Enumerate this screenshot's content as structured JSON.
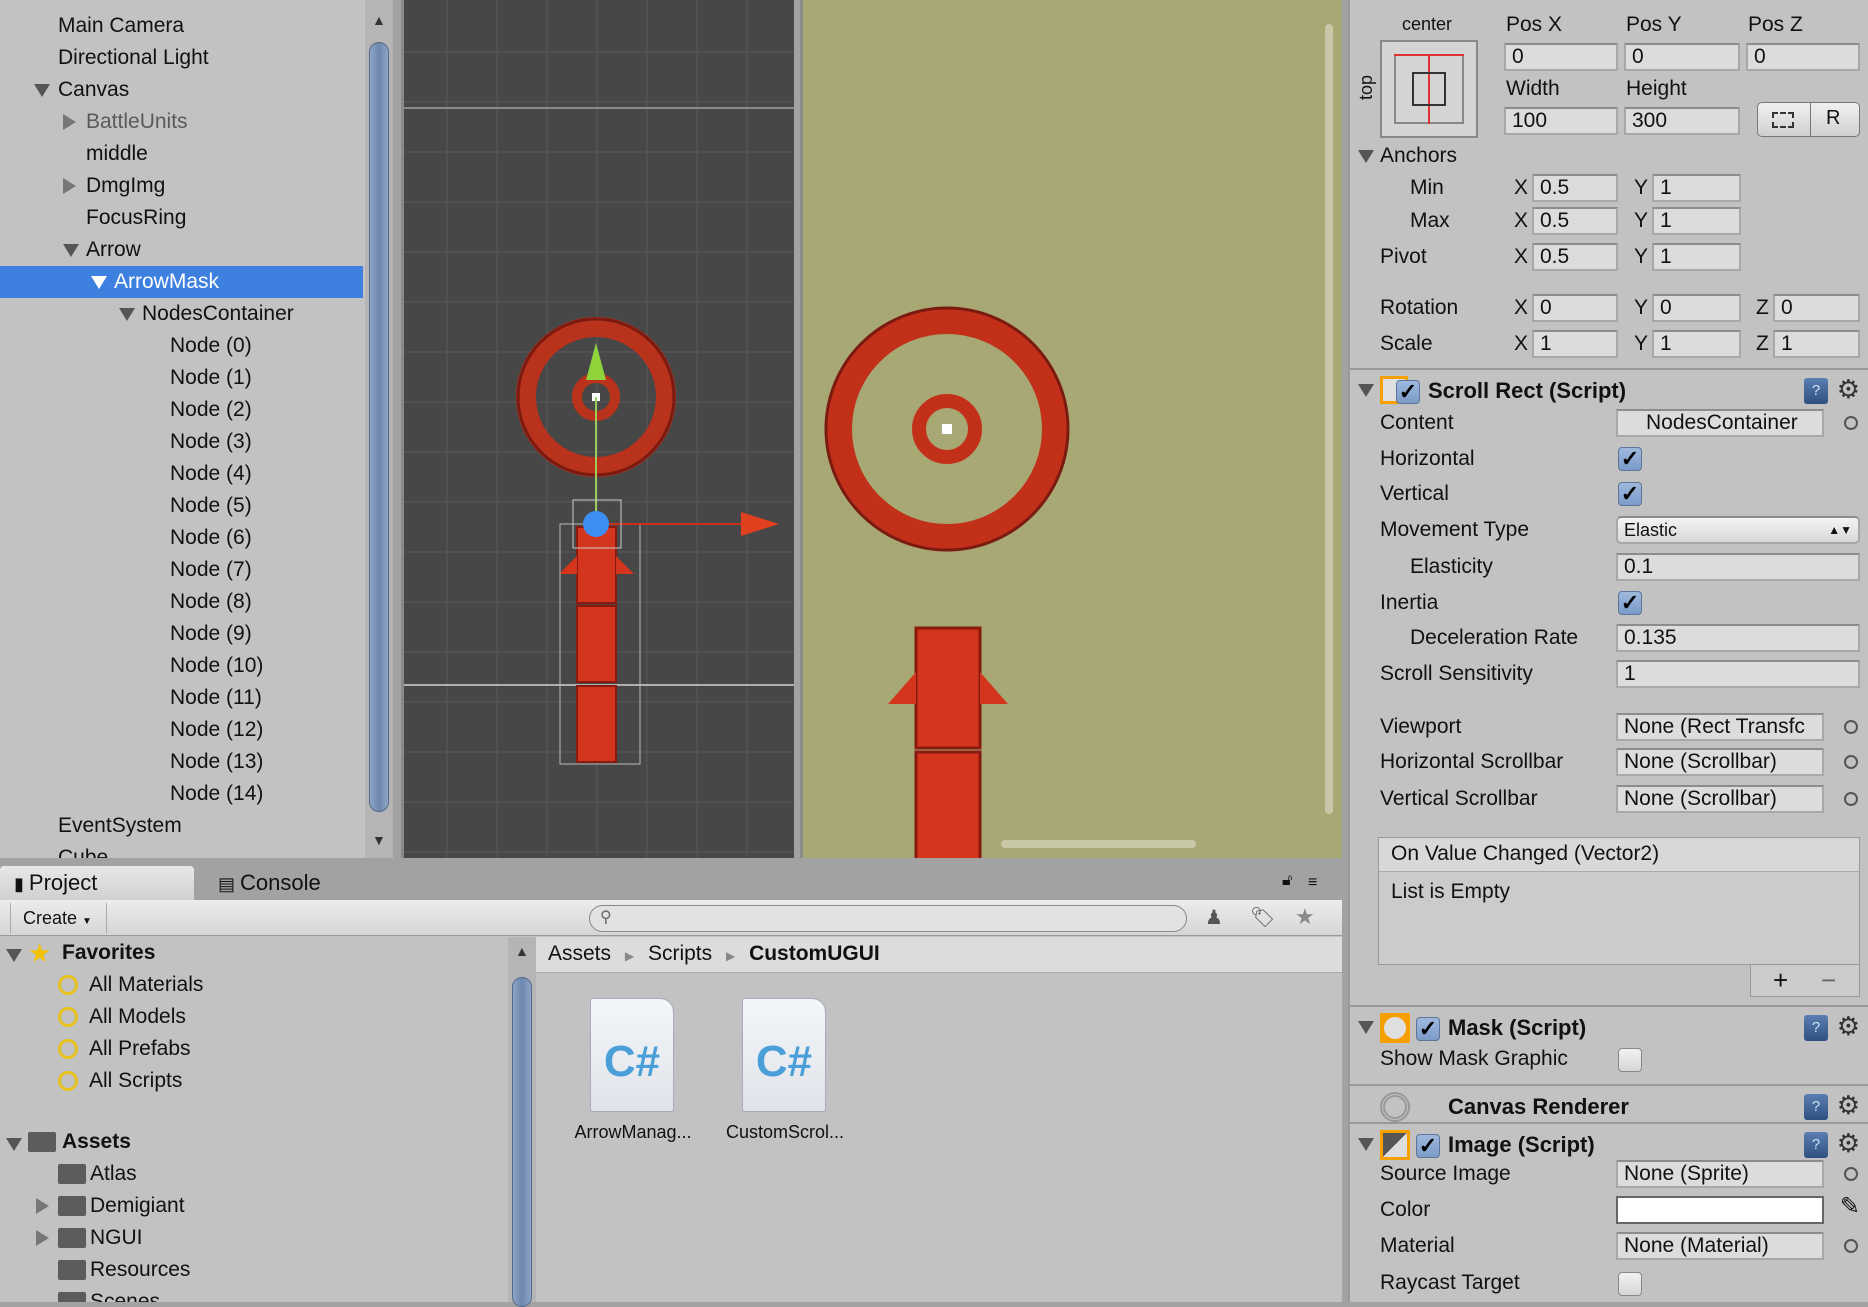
{
  "hierarchy": {
    "items": [
      {
        "label": "Main Camera",
        "indent": 0,
        "arrow": "none"
      },
      {
        "label": "Directional Light",
        "indent": 0,
        "arrow": "none"
      },
      {
        "label": "Canvas",
        "indent": 0,
        "arrow": "down"
      },
      {
        "label": "BattleUnits",
        "indent": 1,
        "arrow": "right",
        "dim": true
      },
      {
        "label": "middle",
        "indent": 1,
        "arrow": "none"
      },
      {
        "label": "DmgImg",
        "indent": 1,
        "arrow": "right"
      },
      {
        "label": "FocusRing",
        "indent": 1,
        "arrow": "none"
      },
      {
        "label": "Arrow",
        "indent": 1,
        "arrow": "down"
      },
      {
        "label": "ArrowMask",
        "indent": 2,
        "arrow": "down",
        "selected": true
      },
      {
        "label": "NodesContainer",
        "indent": 3,
        "arrow": "down"
      },
      {
        "label": "Node (0)",
        "indent": 4,
        "arrow": "none"
      },
      {
        "label": "Node (1)",
        "indent": 4,
        "arrow": "none"
      },
      {
        "label": "Node (2)",
        "indent": 4,
        "arrow": "none"
      },
      {
        "label": "Node (3)",
        "indent": 4,
        "arrow": "none"
      },
      {
        "label": "Node (4)",
        "indent": 4,
        "arrow": "none"
      },
      {
        "label": "Node (5)",
        "indent": 4,
        "arrow": "none"
      },
      {
        "label": "Node (6)",
        "indent": 4,
        "arrow": "none"
      },
      {
        "label": "Node (7)",
        "indent": 4,
        "arrow": "none"
      },
      {
        "label": "Node (8)",
        "indent": 4,
        "arrow": "none"
      },
      {
        "label": "Node (9)",
        "indent": 4,
        "arrow": "none"
      },
      {
        "label": "Node (10)",
        "indent": 4,
        "arrow": "none"
      },
      {
        "label": "Node (11)",
        "indent": 4,
        "arrow": "none"
      },
      {
        "label": "Node (12)",
        "indent": 4,
        "arrow": "none"
      },
      {
        "label": "Node (13)",
        "indent": 4,
        "arrow": "none"
      },
      {
        "label": "Node (14)",
        "indent": 4,
        "arrow": "none"
      },
      {
        "label": "EventSystem",
        "indent": 0,
        "arrow": "none"
      },
      {
        "label": "Cube",
        "indent": 0,
        "arrow": "none"
      }
    ]
  },
  "colors": {
    "selection": "#3d80df",
    "game_bg": "#a7a873",
    "scene_bg": "#474747",
    "target_red": "#c8301a"
  },
  "inspector": {
    "rect": {
      "anchor_h": "center",
      "anchor_v": "top",
      "pos_x_label": "Pos X",
      "pos_y_label": "Pos Y",
      "pos_z_label": "Pos Z",
      "pos_x": "0",
      "pos_y": "0",
      "pos_z": "0",
      "width_label": "Width",
      "height_label": "Height",
      "width": "100",
      "height": "300",
      "r_btn": "R",
      "anchors_label": "Anchors",
      "min_label": "Min",
      "max_label": "Max",
      "pivot_label": "Pivot",
      "rotation_label": "Rotation",
      "scale_label": "Scale",
      "min_x": "0.5",
      "min_y": "1",
      "max_x": "0.5",
      "max_y": "1",
      "pivot_x": "0.5",
      "pivot_y": "1",
      "rot_x": "0",
      "rot_y": "0",
      "rot_z": "0",
      "scale_x": "1",
      "scale_y": "1",
      "scale_z": "1",
      "x": "X",
      "y": "Y",
      "z": "Z"
    },
    "scroll": {
      "title": "Scroll Rect (Script)",
      "content_label": "Content",
      "content": "NodesContainer",
      "horizontal_label": "Horizontal",
      "horizontal": true,
      "vertical_label": "Vertical",
      "vertical": true,
      "movement_label": "Movement Type",
      "movement": "Elastic",
      "elasticity_label": "Elasticity",
      "elasticity": "0.1",
      "inertia_label": "Inertia",
      "inertia": true,
      "decel_label": "Deceleration Rate",
      "decel": "0.135",
      "sens_label": "Scroll Sensitivity",
      "sens": "1",
      "viewport_label": "Viewport",
      "viewport": "None (Rect Transfc",
      "hbar_label": "Horizontal Scrollbar",
      "hbar": "None (Scrollbar)",
      "vbar_label": "Vertical Scrollbar",
      "vbar": "None (Scrollbar)",
      "event_title": "On Value Changed (Vector2)",
      "event_empty": "List is Empty",
      "plus": "+",
      "minus": "−"
    },
    "mask": {
      "title": "Mask (Script)",
      "show_label": "Show Mask Graphic",
      "show": false
    },
    "canvas_renderer": {
      "title": "Canvas Renderer"
    },
    "image": {
      "title": "Image (Script)",
      "source_label": "Source Image",
      "source": "None (Sprite)",
      "color_label": "Color",
      "color": "#ffffff",
      "material_label": "Material",
      "material": "None (Material)",
      "raycast_label": "Raycast Target",
      "raycast": false
    }
  },
  "project": {
    "tabs": [
      {
        "label": "Project"
      },
      {
        "label": "Console"
      }
    ],
    "create": "Create",
    "search_placeholder": "",
    "favorites_label": "Favorites",
    "favorites": [
      "All Materials",
      "All Models",
      "All Prefabs",
      "All Scripts"
    ],
    "assets_label": "Assets",
    "folders": [
      {
        "label": "Atlas",
        "arrow": false
      },
      {
        "label": "Demigiant",
        "arrow": true
      },
      {
        "label": "NGUI",
        "arrow": true
      },
      {
        "label": "Resources",
        "arrow": false
      },
      {
        "label": "Scenes",
        "arrow": false
      }
    ],
    "breadcrumb": [
      "Assets",
      "Scripts",
      "CustomUGUI"
    ],
    "files": [
      {
        "label": "ArrowManag...",
        "icon": "csharp-script-icon",
        "glyph": "C#"
      },
      {
        "label": "CustomScrol...",
        "icon": "csharp-script-icon",
        "glyph": "C#"
      }
    ]
  }
}
